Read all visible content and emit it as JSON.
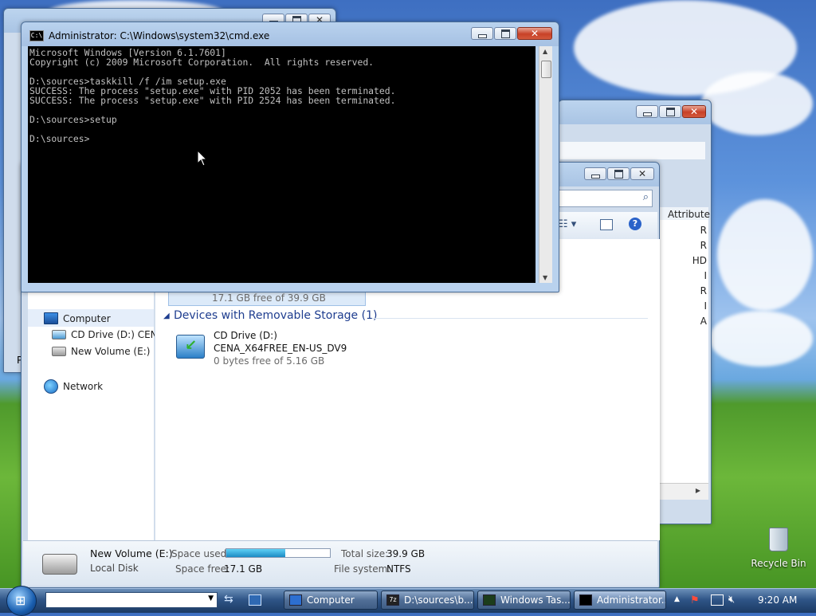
{
  "cmd": {
    "title": "Administrator: C:\\Windows\\system32\\cmd.exe",
    "icon_label": "C:\\",
    "lines": [
      "Microsoft Windows [Version 6.1.7601]",
      "Copyright (c) 2009 Microsoft Corporation.  All rights reserved.",
      "",
      "D:\\sources>taskkill /f /im setup.exe",
      "SUCCESS: The process \"setup.exe\" with PID 2052 has been terminated.",
      "SUCCESS: The process \"setup.exe\" with PID 2524 has been terminated.",
      "",
      "D:\\sources>setup",
      "",
      "D:\\sources>"
    ]
  },
  "explorer": {
    "column_header": "Attribute",
    "column_values": [
      "R",
      "R",
      "HD",
      "I",
      "R",
      "I",
      "A"
    ],
    "nav": {
      "computer": "Computer",
      "cd_drive": "CD Drive (D:) CENA_",
      "new_volume": "New Volume (E:)",
      "network": "Network"
    },
    "partial_drive_free": "17.1 GB free of 39.9 GB",
    "removable_group": "Devices with Removable Storage (1)",
    "cd_item": {
      "name": "CD Drive (D:)",
      "label": "CENA_X64FREE_EN-US_DV9",
      "free": "0 bytes free of 5.16 GB"
    },
    "details": {
      "name": "New Volume (E:)",
      "type": "Local Disk",
      "space_used_label": "Space used:",
      "space_free_label": "Space free:",
      "space_free": "17.1 GB",
      "total_size_label": "Total size:",
      "total_size": "39.9 GB",
      "file_system_label": "File system:",
      "file_system": "NTFS",
      "used_fraction": 0.571
    }
  },
  "back_window": {
    "partial_letter": "P"
  },
  "desktop": {
    "recycle_bin": "Recycle Bin"
  },
  "taskbar": {
    "buttons": [
      {
        "label": "Computer"
      },
      {
        "label": "D:\\sources\\b..."
      },
      {
        "label": "Windows Tas..."
      },
      {
        "label": "Administrator..."
      }
    ],
    "clock": "9:20 AM",
    "address_value": ""
  },
  "colors": {
    "accent": "#1e3d8f",
    "close_red": "#c84127",
    "console_bg": "#000000",
    "console_text": "#c0c0c0"
  }
}
